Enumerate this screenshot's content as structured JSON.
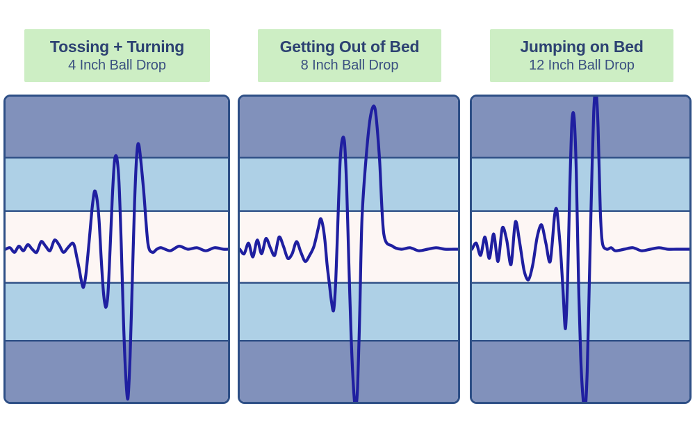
{
  "page": {
    "background": "#ffffff",
    "accent_green": "#cdeec4",
    "navy_text": "#2d4272",
    "panel_border": "#2e4f86",
    "band_dark": "#8191bb",
    "band_light": "#aed0e6",
    "band_center": "#fdf6f4",
    "trace_color": "#1f1fa0"
  },
  "panels": [
    {
      "title": "Tossing + Turning",
      "subtitle": "4 Inch Ball Drop",
      "chart_data": {
        "type": "line",
        "title": "Tossing + Turning",
        "subtitle": "4 Inch Ball Drop",
        "xlabel": "",
        "ylabel": "",
        "grid": true,
        "legend": false,
        "xlim": [
          0,
          100
        ],
        "ylim": [
          -100,
          100
        ],
        "bands": [
          {
            "name": "outer-upper",
            "y_range": [
              60,
              100
            ],
            "color": "#8191bb"
          },
          {
            "name": "inner-upper",
            "y_range": [
              25,
              60
            ],
            "color": "#aed0e6"
          },
          {
            "name": "center",
            "y_range": [
              -22,
              25
            ],
            "color": "#fdf6f4"
          },
          {
            "name": "inner-lower",
            "y_range": [
              -60,
              -22
            ],
            "color": "#aed0e6"
          },
          {
            "name": "outer-lower",
            "y_range": [
              -100,
              -60
            ],
            "color": "#8191bb"
          }
        ],
        "series": [
          {
            "name": "motion-transfer-trace",
            "color": "#1f1fa0",
            "x": [
              0,
              2,
              4,
              6,
              8,
              10,
              12,
              14,
              16,
              18,
              20,
              22,
              24,
              26,
              28,
              30,
              31,
              32,
              33,
              34,
              35,
              36,
              37,
              38,
              39,
              40,
              41,
              42,
              43,
              44,
              45,
              46,
              47,
              48,
              49,
              50,
              51,
              52,
              53,
              54,
              55,
              56,
              57,
              58,
              59,
              60,
              62,
              64,
              66,
              68,
              70,
              74,
              78,
              82,
              86,
              90,
              94,
              98,
              100
            ],
            "y": [
              0,
              1,
              -2,
              2,
              -1,
              3,
              0,
              -2,
              5,
              2,
              -1,
              6,
              3,
              -2,
              1,
              4,
              2,
              -5,
              -12,
              -20,
              -25,
              -18,
              -4,
              12,
              28,
              38,
              34,
              20,
              -6,
              -28,
              -38,
              -30,
              0,
              34,
              58,
              60,
              44,
              4,
              -46,
              -82,
              -98,
              -70,
              -20,
              30,
              62,
              68,
              40,
              4,
              -2,
              0,
              1,
              -1,
              2,
              0,
              1,
              -1,
              1,
              0,
              0
            ]
          }
        ]
      }
    },
    {
      "title": "Getting Out of Bed",
      "subtitle": "8 Inch Ball Drop",
      "chart_data": {
        "type": "line",
        "title": "Getting Out of Bed",
        "subtitle": "8 Inch Ball Drop",
        "xlabel": "",
        "ylabel": "",
        "grid": true,
        "legend": false,
        "xlim": [
          0,
          100
        ],
        "ylim": [
          -100,
          100
        ],
        "bands": [
          {
            "name": "outer-upper",
            "y_range": [
              60,
              100
            ],
            "color": "#8191bb"
          },
          {
            "name": "inner-upper",
            "y_range": [
              25,
              60
            ],
            "color": "#aed0e6"
          },
          {
            "name": "center",
            "y_range": [
              -22,
              25
            ],
            "color": "#fdf6f4"
          },
          {
            "name": "inner-lower",
            "y_range": [
              -60,
              -22
            ],
            "color": "#aed0e6"
          },
          {
            "name": "outer-lower",
            "y_range": [
              -100,
              -60
            ],
            "color": "#8191bb"
          }
        ],
        "series": [
          {
            "name": "motion-transfer-trace",
            "color": "#1f1fa0",
            "x": [
              0,
              2,
              4,
              6,
              8,
              10,
              12,
              14,
              16,
              18,
              20,
              22,
              24,
              26,
              28,
              30,
              32,
              34,
              36,
              37,
              38,
              39,
              40,
              41,
              42,
              43,
              44,
              45,
              46,
              47,
              48,
              49,
              50,
              51,
              52,
              53,
              54,
              55,
              56,
              58,
              60,
              62,
              64,
              66,
              70,
              74,
              78,
              82,
              86,
              90,
              94,
              98,
              100
            ],
            "y": [
              0,
              -3,
              4,
              -5,
              6,
              -3,
              7,
              1,
              -4,
              8,
              2,
              -6,
              -3,
              5,
              -2,
              -8,
              -4,
              2,
              14,
              20,
              16,
              6,
              -10,
              -22,
              -34,
              -40,
              -20,
              20,
              58,
              72,
              70,
              40,
              -10,
              -56,
              -88,
              -104,
              -90,
              -40,
              20,
              62,
              88,
              92,
              60,
              10,
              2,
              0,
              1,
              -1,
              0,
              1,
              0,
              0,
              0
            ]
          }
        ]
      }
    },
    {
      "title": "Jumping on Bed",
      "subtitle": "12 Inch Ball Drop",
      "chart_data": {
        "type": "line",
        "title": "Jumping on Bed",
        "subtitle": "12 Inch Ball Drop",
        "xlabel": "",
        "ylabel": "",
        "grid": true,
        "legend": false,
        "xlim": [
          0,
          100
        ],
        "ylim": [
          -100,
          100
        ],
        "bands": [
          {
            "name": "outer-upper",
            "y_range": [
              60,
              100
            ],
            "color": "#8191bb"
          },
          {
            "name": "inner-upper",
            "y_range": [
              25,
              60
            ],
            "color": "#aed0e6"
          },
          {
            "name": "center",
            "y_range": [
              -22,
              25
            ],
            "color": "#fdf6f4"
          },
          {
            "name": "inner-lower",
            "y_range": [
              -60,
              -22
            ],
            "color": "#aed0e6"
          },
          {
            "name": "outer-lower",
            "y_range": [
              -100,
              -60
            ],
            "color": "#8191bb"
          }
        ],
        "series": [
          {
            "name": "motion-transfer-trace",
            "color": "#1f1fa0",
            "x": [
              0,
              2,
              4,
              6,
              8,
              10,
              12,
              14,
              16,
              18,
              20,
              22,
              24,
              26,
              28,
              30,
              32,
              34,
              36,
              38,
              39,
              40,
              41,
              42,
              43,
              44,
              45,
              46,
              47,
              48,
              49,
              50,
              51,
              52,
              53,
              54,
              55,
              56,
              57,
              58,
              59,
              60,
              62,
              64,
              66,
              70,
              74,
              78,
              82,
              86,
              90,
              94,
              98,
              100
            ],
            "y": [
              0,
              4,
              -4,
              8,
              -6,
              10,
              -8,
              14,
              6,
              -10,
              18,
              4,
              -14,
              -20,
              -10,
              8,
              16,
              4,
              -8,
              22,
              26,
              12,
              -6,
              -30,
              -52,
              -20,
              40,
              84,
              86,
              50,
              -20,
              -70,
              -96,
              -106,
              -80,
              -20,
              40,
              90,
              104,
              80,
              26,
              4,
              0,
              1,
              -1,
              0,
              1,
              -1,
              0,
              1,
              0,
              0,
              0,
              0
            ]
          }
        ]
      }
    }
  ]
}
